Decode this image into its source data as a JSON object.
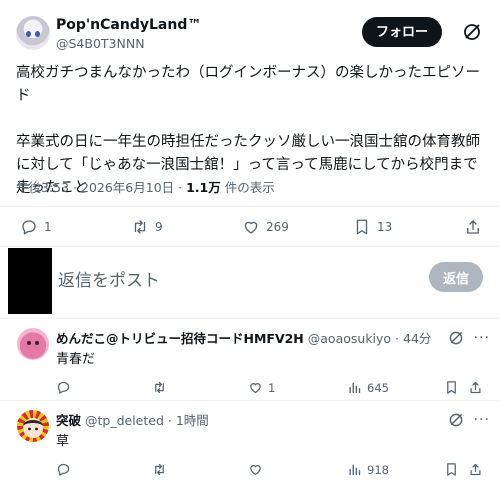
{
  "post": {
    "display_name": "Pop'nCandyLand™",
    "handle": "@S4B0T3NNN",
    "follow_label": "フォロー",
    "text": "高校ガチつまんなかったわ（ログインボーナス）の楽しかったエピソード\n\n卒業式の日に一年生の時担任だったクッソ厳しい一浪国士舘の体育教師に対して「じゃあな一浪国士舘！」って言って馬鹿にしてから校門まで走ったこと",
    "time": "午後3:53 · 2026年6月10日 · ",
    "views_count": "1.1万",
    "views_label": " 件の表示",
    "stats": {
      "replies": "1",
      "reposts": "9",
      "likes": "269",
      "bookmarks": "13"
    }
  },
  "reply_box": {
    "placeholder": "返信をポスト",
    "button_label": "返信"
  },
  "comments": [
    {
      "name": "めんだこ@トリビュー招待コードHMFV2H",
      "handle": "@aoaosukiyo",
      "time": " · 44分",
      "text": "青春だ",
      "likes": "1",
      "views": "645"
    },
    {
      "name": "突破",
      "handle": "@tp_deleted",
      "time": " · 1時間",
      "text": "草",
      "likes": "",
      "views": "918"
    }
  ],
  "colors": {
    "primary_text": "#0f1419",
    "secondary_text": "#536471",
    "follow_bg": "#0f1419",
    "divider": "#eff3f4"
  }
}
